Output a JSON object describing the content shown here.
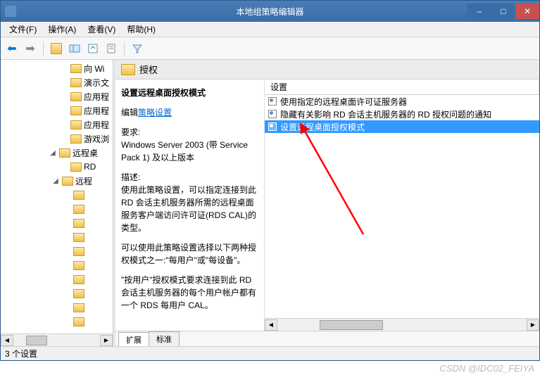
{
  "window": {
    "title": "本地组策略编辑器",
    "minimize_label": "–",
    "maximize_label": "□",
    "close_label": "✕"
  },
  "menu": {
    "file": "文件(F)",
    "action": "操作(A)",
    "view": "查看(V)",
    "help": "帮助(H)"
  },
  "tree": {
    "items": [
      {
        "indent": 84,
        "expand": "",
        "label": "向 Wi"
      },
      {
        "indent": 84,
        "expand": "",
        "label": "演示文"
      },
      {
        "indent": 84,
        "expand": "",
        "label": "应用程"
      },
      {
        "indent": 84,
        "expand": "",
        "label": "应用程"
      },
      {
        "indent": 84,
        "expand": "",
        "label": "应用程"
      },
      {
        "indent": 84,
        "expand": "",
        "label": "游戏浏"
      },
      {
        "indent": 68,
        "expand": "◢",
        "label": "远程桌"
      },
      {
        "indent": 84,
        "expand": "",
        "label": "RD"
      },
      {
        "indent": 72,
        "expand": "◢",
        "label": "远程"
      },
      {
        "indent": 88,
        "expand": "",
        "label": ""
      },
      {
        "indent": 88,
        "expand": "",
        "label": ""
      },
      {
        "indent": 88,
        "expand": "",
        "label": ""
      },
      {
        "indent": 88,
        "expand": "",
        "label": ""
      },
      {
        "indent": 88,
        "expand": "",
        "label": ""
      },
      {
        "indent": 88,
        "expand": "",
        "label": ""
      },
      {
        "indent": 88,
        "expand": "",
        "label": ""
      },
      {
        "indent": 88,
        "expand": "",
        "label": ""
      },
      {
        "indent": 88,
        "expand": "",
        "label": ""
      },
      {
        "indent": 88,
        "expand": "",
        "label": ""
      }
    ]
  },
  "header": {
    "title": "授权"
  },
  "description": {
    "title": "设置远程桌面授权模式",
    "edit_prefix": "编辑",
    "edit_link": "策略设置",
    "req_label": "要求:",
    "req_text": "Windows Server 2003 (带 Service Pack 1) 及以上版本",
    "desc_label": "描述:",
    "p1": "使用此策略设置，可以指定连接到此 RD 会话主机服务器所需的远程桌面服务客户端访问许可证(RDS CAL)的类型。",
    "p2": "可以使用此策略设置选择以下两种授权模式之一:\"每用户\"或\"每设备\"。",
    "p3": "\"按用户\"授权模式要求连接到此 RD 会话主机服务器的每个用户帐户都有一个 RDS 每用户 CAL。"
  },
  "list": {
    "column_header": "设置",
    "rows": [
      {
        "label": "使用指定的远程桌面许可证服务器",
        "selected": false
      },
      {
        "label": "隐藏有关影响 RD 会话主机服务器的 RD 授权问题的通知",
        "selected": false
      },
      {
        "label": "设置远程桌面授权模式",
        "selected": true
      }
    ]
  },
  "tabs": {
    "extended": "扩展",
    "standard": "标准"
  },
  "statusbar": {
    "text": "3 个设置"
  },
  "watermark": "CSDN @IDC02_FEIYA"
}
